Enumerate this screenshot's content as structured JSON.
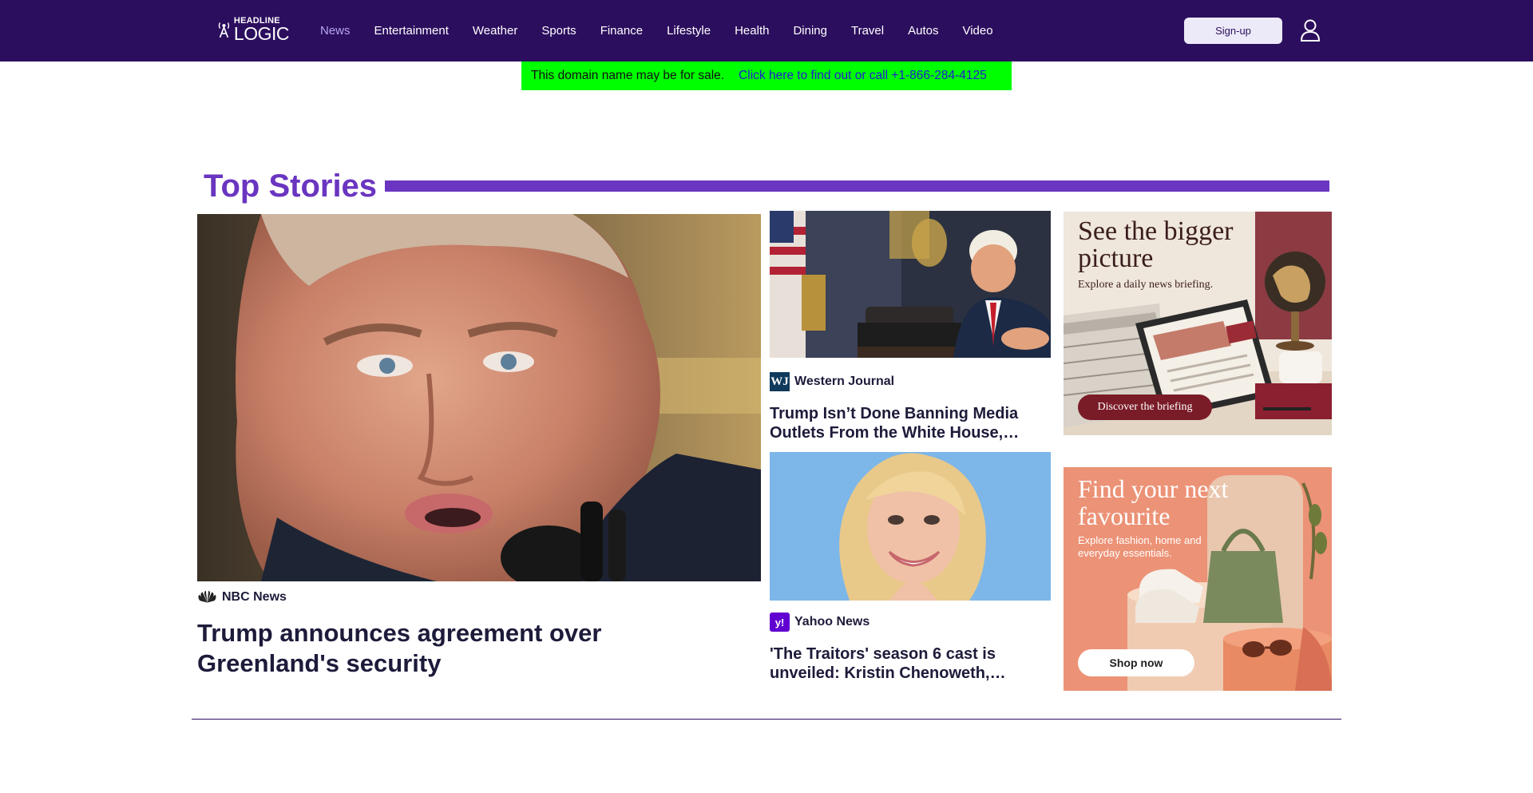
{
  "header": {
    "logo": {
      "top": "HEADLINE",
      "bottom": "LOGIC"
    },
    "nav": [
      "News",
      "Entertainment",
      "Weather",
      "Sports",
      "Finance",
      "Lifestyle",
      "Health",
      "Dining",
      "Travel",
      "Autos",
      "Video"
    ],
    "active_nav": "News",
    "signup_label": "Sign-up"
  },
  "banner": {
    "text": "This domain name may be for sale.",
    "link": "Click here to find out or call +1-866-284-4125"
  },
  "section": {
    "title": "Top Stories"
  },
  "main_story": {
    "source": "NBC News",
    "headline": "Trump announces agreement over Greenland's security"
  },
  "side_stories": [
    {
      "source": "Western Journal",
      "headline_line1": "Trump Isn’t Done Banning Media",
      "headline_line2": "Outlets From the White House,…"
    },
    {
      "source": "Yahoo News",
      "headline_line1": "'The Traitors' season 6 cast is",
      "headline_line2": "unveiled: Kristin Chenoweth,…"
    }
  ],
  "ads": [
    {
      "title_line1": "See the bigger",
      "title_line2": "picture",
      "subtitle": "Explore a daily news briefing.",
      "button": "Discover the briefing"
    },
    {
      "title_line1": "Find your next",
      "title_line2": "favourite",
      "subtitle_line1": "Explore fashion, home and",
      "subtitle_line2": "everyday essentials.",
      "button": "Shop now"
    }
  ],
  "colors": {
    "header_bg": "#2c0e5e",
    "accent": "#6a35c0",
    "banner_bg": "#00ff00",
    "link": "#2020d0"
  }
}
